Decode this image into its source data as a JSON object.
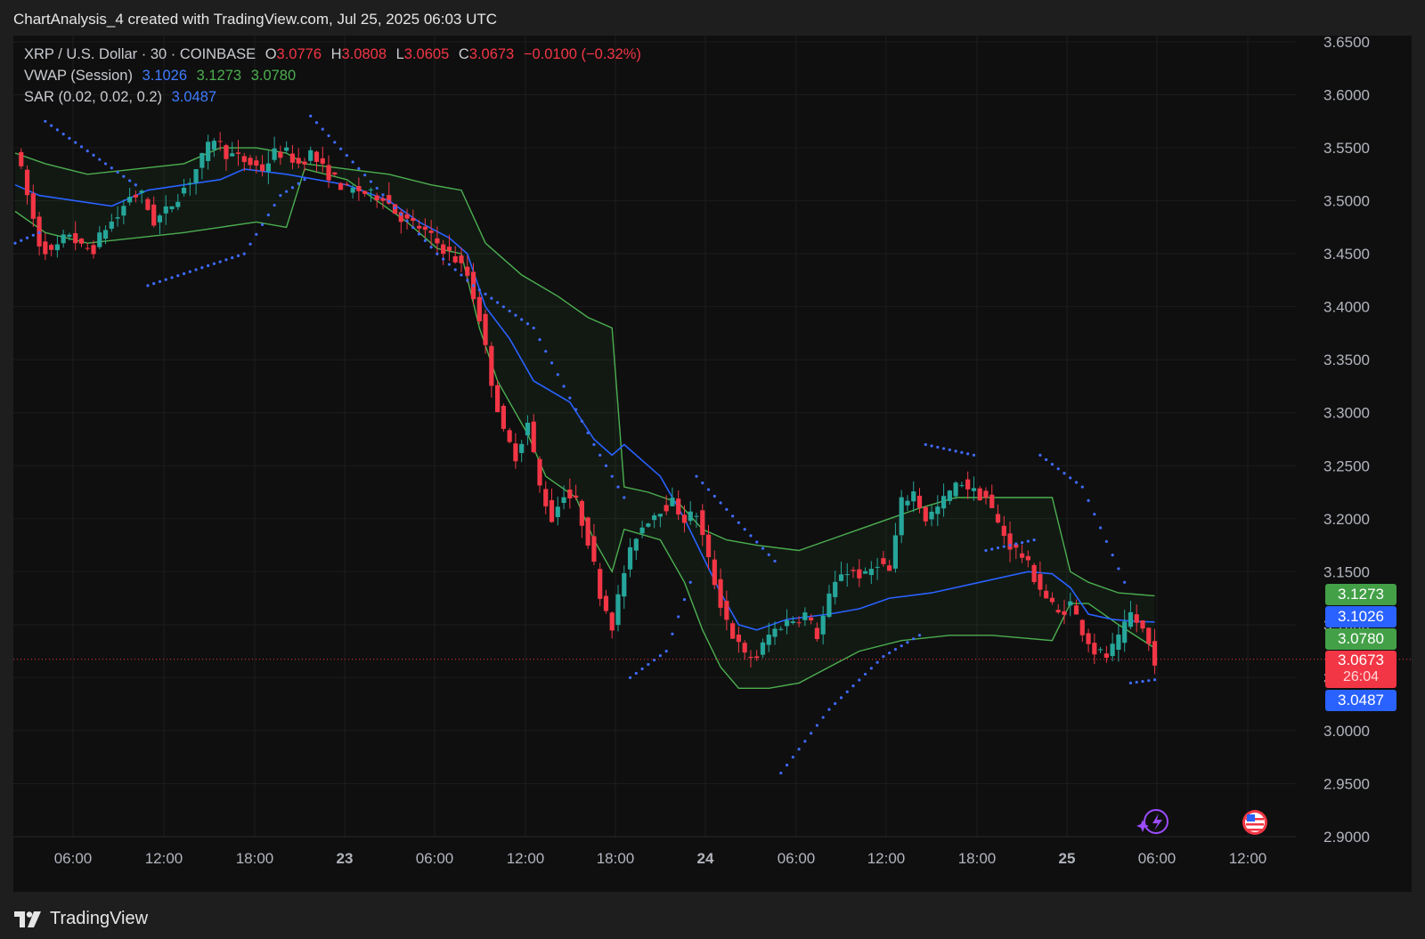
{
  "header": {
    "title": "ChartAnalysis_4 created with TradingView.com, Jul 25, 2025 06:03 UTC"
  },
  "legend": {
    "symbol": "XRP / U.S. Dollar · 30 · COINBASE",
    "open_label": "O",
    "open": "3.0776",
    "high_label": "H",
    "high": "3.0808",
    "low_label": "L",
    "low": "3.0605",
    "close_label": "C",
    "close": "3.0673",
    "change": "−0.0100 (−0.32%)",
    "vwap_label": "VWAP (Session)",
    "vwap_main": "3.1026",
    "vwap_upper": "3.1273",
    "vwap_lower": "3.0780",
    "sar_label": "SAR (0.02, 0.02, 0.2)",
    "sar_value": "3.0487"
  },
  "price_tags": {
    "upper": "3.1273",
    "vwap": "3.1026",
    "lower": "3.0780",
    "last": "3.0673",
    "countdown": "26:04",
    "sar": "3.0487"
  },
  "footer": {
    "brand": "TradingView"
  },
  "colors": {
    "up": "#26a69a",
    "down": "#f23645",
    "vwap": "#2962ff",
    "band": "#4caf50",
    "sar": "#3f6bff",
    "background": "#0f0f0f"
  },
  "icons": [
    "ai-sparkle-icon",
    "us-flag-icon"
  ],
  "chart_data": {
    "type": "candlestick",
    "title": "XRP / U.S. Dollar · 30 · COINBASE",
    "y_ticks": [
      "3.6500",
      "3.6000",
      "3.5500",
      "3.5000",
      "3.4500",
      "3.4000",
      "3.3500",
      "3.3000",
      "3.2500",
      "3.2000",
      "3.1500",
      "3.1000",
      "3.0500",
      "3.0000",
      "2.9500",
      "2.9000"
    ],
    "ylim": [
      2.9,
      3.65
    ],
    "x_ticks": [
      "06:00",
      "12:00",
      "18:00",
      "23",
      "06:00",
      "12:00",
      "18:00",
      "24",
      "06:00",
      "12:00",
      "18:00",
      "25",
      "06:00",
      "12:00"
    ],
    "x_ticks_bold": [
      false,
      false,
      false,
      true,
      false,
      false,
      false,
      true,
      false,
      false,
      false,
      true,
      false,
      false
    ],
    "grid": true,
    "last_price": 3.0673,
    "anchors": [
      [
        0,
        3.55
      ],
      [
        4,
        3.46
      ],
      [
        6,
        3.45
      ],
      [
        9,
        3.47
      ],
      [
        11,
        3.455
      ],
      [
        13,
        3.455
      ],
      [
        15,
        3.475
      ],
      [
        17,
        3.485
      ],
      [
        19,
        3.505
      ],
      [
        21,
        3.505
      ],
      [
        23,
        3.48
      ],
      [
        25,
        3.49
      ],
      [
        27,
        3.505
      ],
      [
        29,
        3.52
      ],
      [
        31,
        3.54
      ],
      [
        33,
        3.56
      ],
      [
        35,
        3.545
      ],
      [
        37,
        3.54
      ],
      [
        39,
        3.535
      ],
      [
        41,
        3.53
      ],
      [
        43,
        3.545
      ],
      [
        45,
        3.545
      ],
      [
        47,
        3.535
      ],
      [
        49,
        3.545
      ],
      [
        51,
        3.53
      ],
      [
        53,
        3.52
      ],
      [
        55,
        3.51
      ],
      [
        57,
        3.51
      ],
      [
        59,
        3.505
      ],
      [
        61,
        3.505
      ],
      [
        63,
        3.49
      ],
      [
        65,
        3.48
      ],
      [
        67,
        3.475
      ],
      [
        69,
        3.465
      ],
      [
        71,
        3.455
      ],
      [
        73,
        3.445
      ],
      [
        75,
        3.43
      ],
      [
        77,
        3.39
      ],
      [
        79,
        3.33
      ],
      [
        81,
        3.28
      ],
      [
        83,
        3.26
      ],
      [
        85,
        3.29
      ],
      [
        87,
        3.23
      ],
      [
        89,
        3.2
      ],
      [
        91,
        3.225
      ],
      [
        93,
        3.215
      ],
      [
        95,
        3.18
      ],
      [
        97,
        3.13
      ],
      [
        99,
        3.1
      ],
      [
        101,
        3.15
      ],
      [
        103,
        3.185
      ],
      [
        105,
        3.2
      ],
      [
        107,
        3.21
      ],
      [
        109,
        3.215
      ],
      [
        111,
        3.2
      ],
      [
        113,
        3.205
      ],
      [
        115,
        3.16
      ],
      [
        117,
        3.12
      ],
      [
        119,
        3.09
      ],
      [
        121,
        3.07
      ],
      [
        123,
        3.07
      ],
      [
        125,
        3.09
      ],
      [
        127,
        3.1
      ],
      [
        129,
        3.105
      ],
      [
        131,
        3.11
      ],
      [
        133,
        3.09
      ],
      [
        135,
        3.125
      ],
      [
        137,
        3.15
      ],
      [
        139,
        3.15
      ],
      [
        141,
        3.145
      ],
      [
        143,
        3.16
      ],
      [
        145,
        3.15
      ],
      [
        147,
        3.215
      ],
      [
        149,
        3.225
      ],
      [
        151,
        3.2
      ],
      [
        153,
        3.21
      ],
      [
        155,
        3.225
      ],
      [
        157,
        3.235
      ],
      [
        159,
        3.225
      ],
      [
        161,
        3.22
      ],
      [
        163,
        3.195
      ],
      [
        165,
        3.175
      ],
      [
        167,
        3.165
      ],
      [
        169,
        3.145
      ],
      [
        171,
        3.125
      ],
      [
        173,
        3.11
      ],
      [
        175,
        3.12
      ],
      [
        177,
        3.095
      ],
      [
        179,
        3.075
      ],
      [
        181,
        3.07
      ],
      [
        183,
        3.085
      ],
      [
        185,
        3.11
      ],
      [
        187,
        3.095
      ],
      [
        189,
        3.0673
      ]
    ],
    "vwap": [
      [
        0,
        3.515
      ],
      [
        4,
        3.505
      ],
      [
        10,
        3.5
      ],
      [
        16,
        3.495
      ],
      [
        22,
        3.51
      ],
      [
        28,
        3.515
      ],
      [
        34,
        3.52
      ],
      [
        38,
        3.53
      ],
      [
        45,
        3.525
      ],
      [
        55,
        3.515
      ],
      [
        62,
        3.5
      ],
      [
        67,
        3.48
      ],
      [
        72,
        3.465
      ],
      [
        75,
        3.45
      ],
      [
        78,
        3.4
      ],
      [
        82,
        3.37
      ],
      [
        86,
        3.33
      ],
      [
        92,
        3.31
      ],
      [
        96,
        3.275
      ],
      [
        99,
        3.26
      ],
      [
        101,
        3.27
      ],
      [
        107,
        3.24
      ],
      [
        111,
        3.2
      ],
      [
        114,
        3.165
      ],
      [
        117,
        3.13
      ],
      [
        120,
        3.1
      ],
      [
        123,
        3.095
      ],
      [
        128,
        3.105
      ],
      [
        135,
        3.11
      ],
      [
        140,
        3.115
      ],
      [
        145,
        3.125
      ],
      [
        152,
        3.13
      ],
      [
        160,
        3.14
      ],
      [
        168,
        3.15
      ],
      [
        172,
        3.148
      ],
      [
        175,
        3.135
      ],
      [
        178,
        3.11
      ],
      [
        182,
        3.105
      ],
      [
        186,
        3.103
      ],
      [
        189,
        3.1026
      ]
    ],
    "vwap_upper": [
      [
        0,
        3.545
      ],
      [
        5,
        3.535
      ],
      [
        12,
        3.525
      ],
      [
        20,
        3.53
      ],
      [
        28,
        3.535
      ],
      [
        34,
        3.55
      ],
      [
        40,
        3.55
      ],
      [
        45,
        3.545
      ],
      [
        48,
        3.535
      ],
      [
        55,
        3.53
      ],
      [
        62,
        3.525
      ],
      [
        69,
        3.515
      ],
      [
        74,
        3.51
      ],
      [
        78,
        3.46
      ],
      [
        84,
        3.43
      ],
      [
        90,
        3.41
      ],
      [
        95,
        3.39
      ],
      [
        99,
        3.38
      ],
      [
        101,
        3.23
      ],
      [
        105,
        3.225
      ],
      [
        110,
        3.215
      ],
      [
        114,
        3.19
      ],
      [
        118,
        3.18
      ],
      [
        123,
        3.175
      ],
      [
        130,
        3.17
      ],
      [
        135,
        3.18
      ],
      [
        140,
        3.19
      ],
      [
        145,
        3.2
      ],
      [
        150,
        3.21
      ],
      [
        156,
        3.22
      ],
      [
        162,
        3.22
      ],
      [
        172,
        3.22
      ],
      [
        175,
        3.15
      ],
      [
        178,
        3.14
      ],
      [
        183,
        3.13
      ],
      [
        189,
        3.1273
      ]
    ],
    "vwap_lower": [
      [
        0,
        3.49
      ],
      [
        5,
        3.47
      ],
      [
        12,
        3.46
      ],
      [
        20,
        3.465
      ],
      [
        28,
        3.47
      ],
      [
        34,
        3.475
      ],
      [
        40,
        3.48
      ],
      [
        45,
        3.475
      ],
      [
        48,
        3.53
      ],
      [
        55,
        3.52
      ],
      [
        60,
        3.5
      ],
      [
        65,
        3.48
      ],
      [
        70,
        3.455
      ],
      [
        74,
        3.45
      ],
      [
        77,
        3.38
      ],
      [
        80,
        3.33
      ],
      [
        85,
        3.28
      ],
      [
        88,
        3.24
      ],
      [
        93,
        3.22
      ],
      [
        96,
        3.18
      ],
      [
        99,
        3.15
      ],
      [
        101,
        3.19
      ],
      [
        107,
        3.18
      ],
      [
        111,
        3.14
      ],
      [
        114,
        3.095
      ],
      [
        117,
        3.06
      ],
      [
        120,
        3.04
      ],
      [
        125,
        3.04
      ],
      [
        130,
        3.045
      ],
      [
        135,
        3.06
      ],
      [
        140,
        3.075
      ],
      [
        147,
        3.085
      ],
      [
        155,
        3.09
      ],
      [
        162,
        3.09
      ],
      [
        172,
        3.085
      ],
      [
        175,
        3.12
      ],
      [
        178,
        3.12
      ],
      [
        183,
        3.1
      ],
      [
        189,
        3.078
      ]
    ],
    "sar_segments": [
      [
        [
          0,
          3.46
        ],
        [
          4,
          3.47
        ]
      ],
      [
        [
          5,
          3.575
        ],
        [
          20,
          3.515
        ]
      ],
      [
        [
          22,
          3.42
        ],
        [
          38,
          3.45
        ],
        [
          44,
          3.505
        ],
        [
          48,
          3.52
        ]
      ],
      [
        [
          49,
          3.58
        ],
        [
          70,
          3.45
        ],
        [
          76,
          3.42
        ],
        [
          86,
          3.38
        ],
        [
          96,
          3.27
        ],
        [
          101,
          3.22
        ]
      ],
      [
        [
          102,
          3.05
        ],
        [
          108,
          3.075
        ],
        [
          112,
          3.14
        ]
      ],
      [
        [
          113,
          3.24
        ],
        [
          121,
          3.19
        ],
        [
          126,
          3.16
        ]
      ],
      [
        [
          127,
          2.96
        ],
        [
          135,
          3.02
        ],
        [
          144,
          3.07
        ],
        [
          150,
          3.09
        ]
      ],
      [
        [
          151,
          3.27
        ],
        [
          159,
          3.26
        ]
      ],
      [
        [
          161,
          3.17
        ],
        [
          169,
          3.18
        ]
      ],
      [
        [
          170,
          3.26
        ],
        [
          177,
          3.23
        ],
        [
          184,
          3.14
        ]
      ],
      [
        [
          185,
          3.045
        ],
        [
          189,
          3.048
        ]
      ]
    ]
  }
}
